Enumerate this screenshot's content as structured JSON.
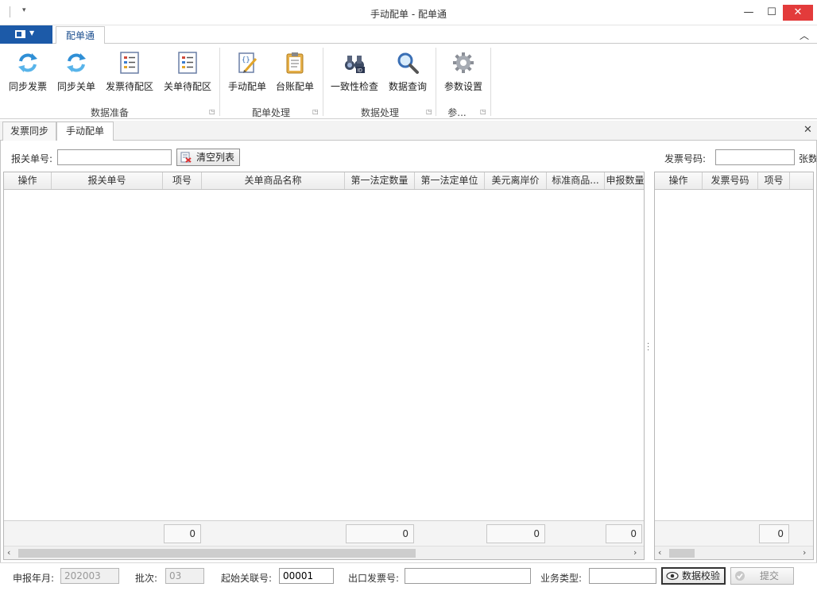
{
  "window": {
    "title": "手动配单 - 配单通",
    "minimize_glyph": "—",
    "maximize_glyph": "☐",
    "close_glyph": "✕"
  },
  "ribbon": {
    "tab": "配单通",
    "groups": [
      {
        "label": "数据准备",
        "buttons": [
          "同步发票",
          "同步关单",
          "发票待配区",
          "关单待配区"
        ]
      },
      {
        "label": "配单处理",
        "buttons": [
          "手动配单",
          "台账配单"
        ]
      },
      {
        "label": "数据处理",
        "buttons": [
          "一致性检查",
          "数据查询"
        ]
      },
      {
        "label": "参...",
        "buttons": [
          "参数设置"
        ]
      }
    ]
  },
  "doc_tabs": [
    "发票同步",
    "手动配单"
  ],
  "left_panel": {
    "filter_label": "报关单号:",
    "filter_value": "",
    "clear_button": "清空列表",
    "columns": [
      "操作",
      "报关单号",
      "项号",
      "关单商品名称",
      "第一法定数量",
      "第一法定单位",
      "美元离岸价",
      "标准商品...",
      "申报数量"
    ],
    "footer_sums": [
      "0",
      "0",
      "0",
      "0"
    ]
  },
  "right_panel": {
    "filter_label": "发票号码:",
    "filter_value": "",
    "extra_label": "张数",
    "columns": [
      "操作",
      "发票号码",
      "项号"
    ],
    "footer_sums": [
      "0"
    ]
  },
  "bottom": {
    "period_label": "申报年月:",
    "period_value": "202003",
    "batch_label": "批次:",
    "batch_value": "03",
    "start_no_label": "起始关联号:",
    "start_no_value": "00001",
    "invoice_label": "出口发票号:",
    "invoice_value": "",
    "biz_type_label": "业务类型:",
    "biz_type_value": "",
    "validate_button": "数据校验",
    "submit_button": "提交"
  },
  "icons": {
    "sync": "sync-arrows-icon",
    "list": "list-icon",
    "edit": "edit-document-icon",
    "clipboard": "clipboard-icon",
    "binoculars": "binoculars-icon",
    "magnifier": "magnifier-icon",
    "gear": "gear-icon",
    "eye": "eye-icon",
    "check": "check-icon"
  }
}
